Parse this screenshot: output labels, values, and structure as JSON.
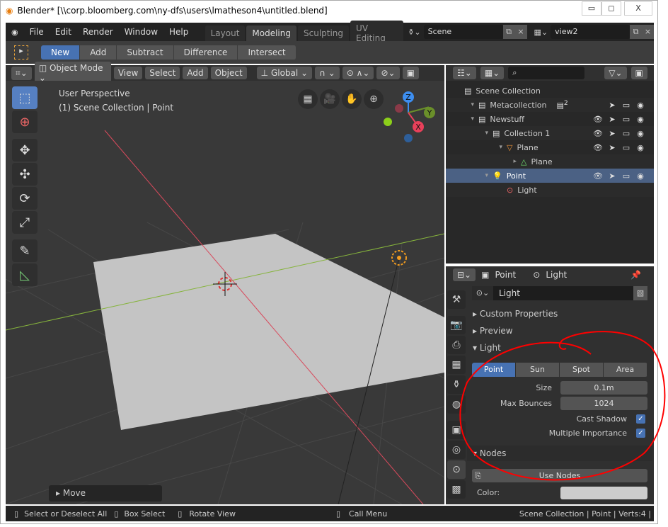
{
  "window": {
    "title": "Blender* [\\\\corp.bloomberg.com\\ny-dfs\\users\\lmatheson4\\untitled.blend]",
    "minimize": "▭",
    "maximize": "◻",
    "close": "X"
  },
  "topbar": {
    "menus": [
      "File",
      "Edit",
      "Render",
      "Window",
      "Help"
    ],
    "workspaces": [
      {
        "label": "Layout",
        "active": false
      },
      {
        "label": "Modeling",
        "active": true
      },
      {
        "label": "Sculpting",
        "active": false
      },
      {
        "label": "UV Editing",
        "active": false
      }
    ],
    "scene": "Scene",
    "view_layer": "view2"
  },
  "toolsettings": {
    "ops": [
      {
        "label": "New",
        "active": true
      },
      {
        "label": "Add",
        "active": false
      },
      {
        "label": "Subtract",
        "active": false
      },
      {
        "label": "Difference",
        "active": false
      },
      {
        "label": "Intersect",
        "active": false
      }
    ]
  },
  "viewport": {
    "mode": "Object Mode",
    "menus": [
      "View",
      "Select",
      "Add",
      "Object"
    ],
    "orientation": "Global",
    "info_line1": "User Perspective",
    "info_line2": "(1) Scene Collection | Point",
    "last_op": "Move",
    "gizmo": {
      "x": "X",
      "y": "Y",
      "z": "Z"
    },
    "colors": {
      "x_axis": "#d84a5c",
      "y_axis": "#86b43c",
      "plane": "#c4c4c4"
    }
  },
  "outliner": {
    "search_placeholder": "",
    "rows": [
      {
        "label": "Scene Collection",
        "icon": "collection-icon",
        "indent": 0
      },
      {
        "label": "Metacollection",
        "icon": "collection-icon",
        "indent": 1,
        "eye": false,
        "badge": "2"
      },
      {
        "label": "Newstuff",
        "icon": "collection-icon",
        "indent": 1,
        "eye": true
      },
      {
        "label": "Collection 1",
        "icon": "collection-icon",
        "indent": 2,
        "eye": true
      },
      {
        "label": "Plane",
        "icon": "mesh-object-icon",
        "indent": 3,
        "eye": true
      },
      {
        "label": "Plane",
        "icon": "mesh-data-icon",
        "indent": 4
      },
      {
        "label": "Point",
        "icon": "light-object-icon",
        "indent": 2,
        "eye": true,
        "selected": true
      },
      {
        "label": "Light",
        "icon": "light-data-icon",
        "indent": 3
      }
    ]
  },
  "properties": {
    "breadcrumb_object": "Point",
    "breadcrumb_data": "Light",
    "datablock": "Light",
    "panels": {
      "custom": "Custom Properties",
      "preview": "Preview",
      "light": "Light",
      "nodes": "Nodes"
    },
    "light_types": [
      {
        "label": "Point",
        "active": true
      },
      {
        "label": "Sun",
        "active": false
      },
      {
        "label": "Spot",
        "active": false
      },
      {
        "label": "Area",
        "active": false
      }
    ],
    "size_label": "Size",
    "size": "0.1m",
    "bounces_label": "Max Bounces",
    "bounces": "1024",
    "cast_shadow_label": "Cast Shadow",
    "cast_shadow": true,
    "mis_label": "Multiple Importance",
    "mis": true,
    "use_nodes": "Use Nodes",
    "color_label": "Color:",
    "color_value": "#cccccc"
  },
  "status": {
    "hints": [
      "Select or Deselect All",
      "Box Select",
      "Rotate View",
      "Call Menu"
    ],
    "info": "Scene Collection | Point | Verts:4 |"
  },
  "annotation_color": "#ff0000"
}
